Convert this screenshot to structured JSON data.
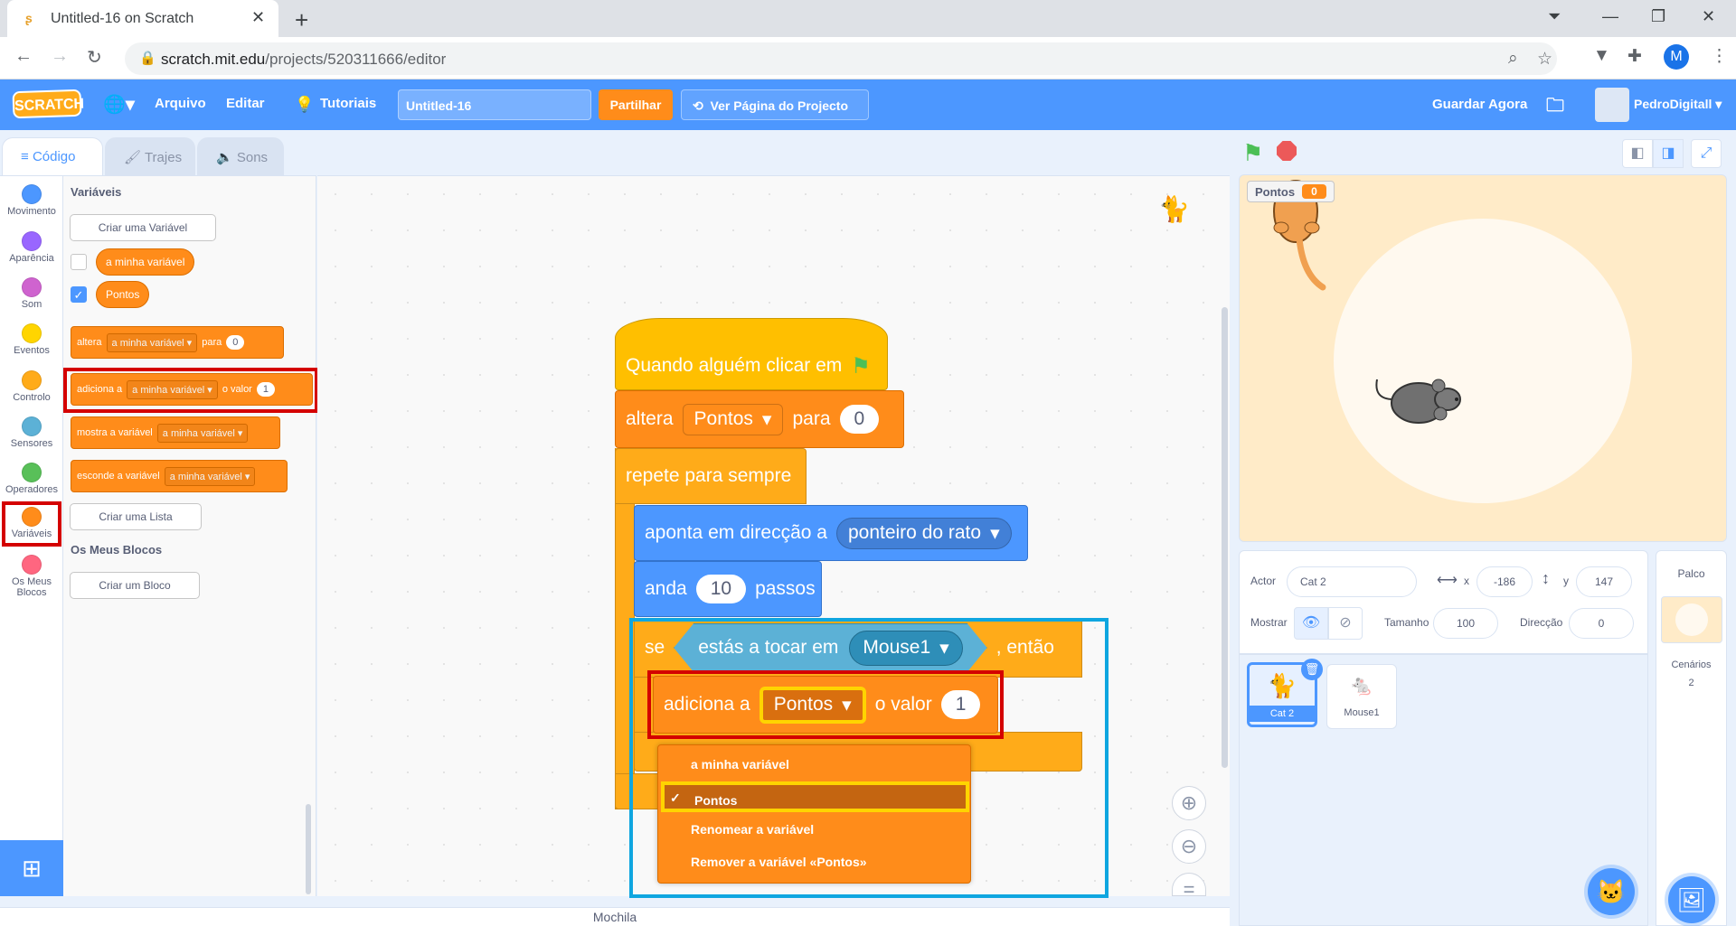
{
  "browser": {
    "tab_title": "Untitled-16 on Scratch",
    "url_host": "scratch.mit.edu",
    "url_path": "/projects/520311666/editor",
    "profile_initial": "M"
  },
  "menu": {
    "logo": "SCRATCH",
    "file": "Arquivo",
    "edit": "Editar",
    "tutorials": "Tutoriais",
    "project_title": "Untitled-16",
    "share": "Partilhar",
    "see_project": "Ver Página do Projecto",
    "save_now": "Guardar Agora",
    "username": "PedroDigitall"
  },
  "tabs": {
    "code": "Código",
    "costumes": "Trajes",
    "sounds": "Sons"
  },
  "categories": [
    {
      "label": "Movimento",
      "color": "#4c97ff"
    },
    {
      "label": "Aparência",
      "color": "#9966ff"
    },
    {
      "label": "Som",
      "color": "#cf63cf"
    },
    {
      "label": "Eventos",
      "color": "#ffd500"
    },
    {
      "label": "Controlo",
      "color": "#ffab19"
    },
    {
      "label": "Sensores",
      "color": "#5cb1d6"
    },
    {
      "label": "Operadores",
      "color": "#59c059"
    },
    {
      "label": "Variáveis",
      "color": "#ff8c1a"
    },
    {
      "label": "Os Meus Blocos",
      "color": "#ff6680"
    }
  ],
  "palette": {
    "section_variables": "Variáveis",
    "make_variable": "Criar uma Variável",
    "var_my": "a minha variável",
    "var_points": "Pontos",
    "set_block": {
      "a": "altera",
      "dd": "a minha variável",
      "b": "para",
      "v": "0"
    },
    "change_block": {
      "a": "adiciona a",
      "dd": "a minha variável",
      "b": "o valor",
      "v": "1"
    },
    "show_block": {
      "a": "mostra a variável",
      "dd": "a minha variável"
    },
    "hide_block": {
      "a": "esconde a variável",
      "dd": "a minha variável"
    },
    "make_list": "Criar uma Lista",
    "section_myblocks": "Os Meus Blocos",
    "make_block": "Criar um Bloco"
  },
  "script": {
    "hat": "Quando alguém clicar em",
    "set": {
      "a": "altera",
      "dd": "Pontos",
      "b": "para",
      "v": "0"
    },
    "forever": "repete para sempre",
    "point": {
      "a": "aponta em direcção a",
      "dd": "ponteiro do rato"
    },
    "move": {
      "a": "anda",
      "v": "10",
      "b": "passos"
    },
    "if": {
      "a": "se",
      "cond": "estás a tocar em",
      "dd": "Mouse1",
      "b": ", então"
    },
    "change": {
      "a": "adiciona a",
      "dd": "Pontos",
      "b": "o valor",
      "v": "1"
    }
  },
  "dropdown": {
    "items": [
      "a minha variável",
      "Pontos",
      "Renomear a variável",
      "Remover a variável «Pontos»"
    ],
    "selected_index": 1,
    "check": "✓"
  },
  "backpack": "Mochila",
  "stage": {
    "monitor_label": "Pontos",
    "monitor_value": "0"
  },
  "sprite_info": {
    "sprite_label": "Actor",
    "sprite_name": "Cat 2",
    "x_label": "x",
    "x": "-186",
    "y_label": "y",
    "y": "147",
    "show_label": "Mostrar",
    "size_label": "Tamanho",
    "size": "100",
    "direction_label": "Direcção",
    "direction": "0"
  },
  "sprites": [
    {
      "name": "Cat 2",
      "selected": true
    },
    {
      "name": "Mouse1",
      "selected": false
    }
  ],
  "stage_panel": {
    "title": "Palco",
    "backdrops_label": "Cenários",
    "backdrops_count": "2"
  }
}
